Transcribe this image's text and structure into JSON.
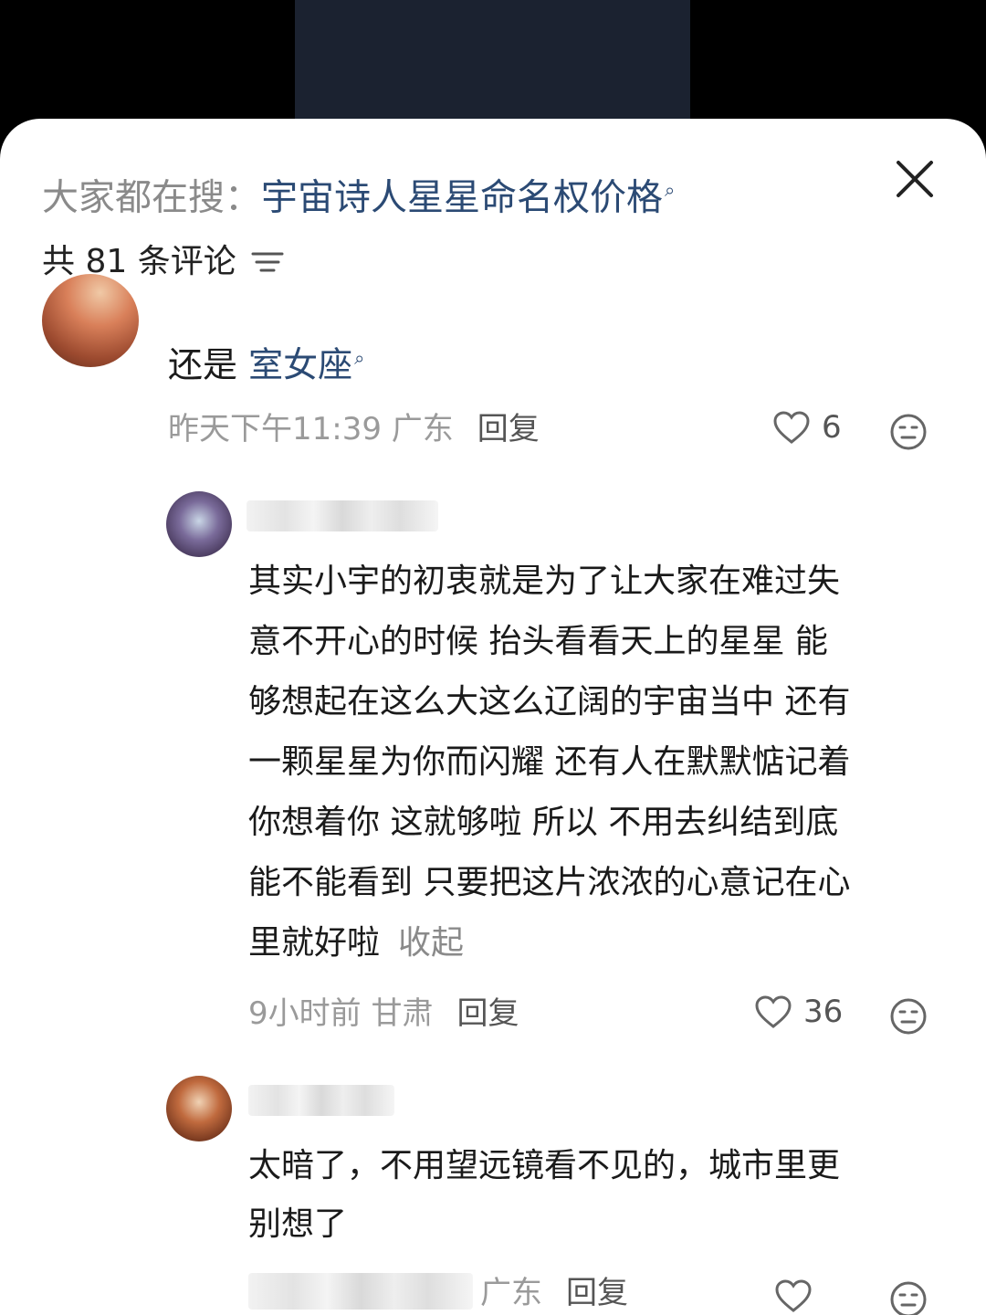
{
  "search": {
    "prefix": "大家都在搜：",
    "term": "宇宙诗人星星命名权价格"
  },
  "header": {
    "comment_count_label": "共 81 条评论"
  },
  "comments": [
    {
      "text_prefix": "还是 ",
      "text_link": "室女座",
      "meta": "昨天下午11:39 广东",
      "reply_label": "回复",
      "likes": "6"
    },
    {
      "lines": [
        "其实小宇的初衷就是为了让大家在难过失",
        "意不开心的时候 抬头看看天上的星星 能",
        "够想起在这么大这么辽阔的宇宙当中 还有",
        "一颗星星为你而闪耀 还有人在默默惦记着",
        "你想着你 这就够啦 所以 不用去纠结到底",
        "能不能看到 只要把这片浓浓的心意记在心",
        "里就好啦"
      ],
      "collapse_label": "收起",
      "meta": "9小时前 甘肃",
      "reply_label": "回复",
      "likes": "36"
    },
    {
      "lines": [
        "太暗了，不用望远镜看不见的，城市里更",
        "别想了"
      ],
      "meta": "广东",
      "reply_label": "回复"
    }
  ],
  "colors": {
    "link": "#2b4a74",
    "muted": "#9a9a9a",
    "text": "#1a1a1a"
  }
}
